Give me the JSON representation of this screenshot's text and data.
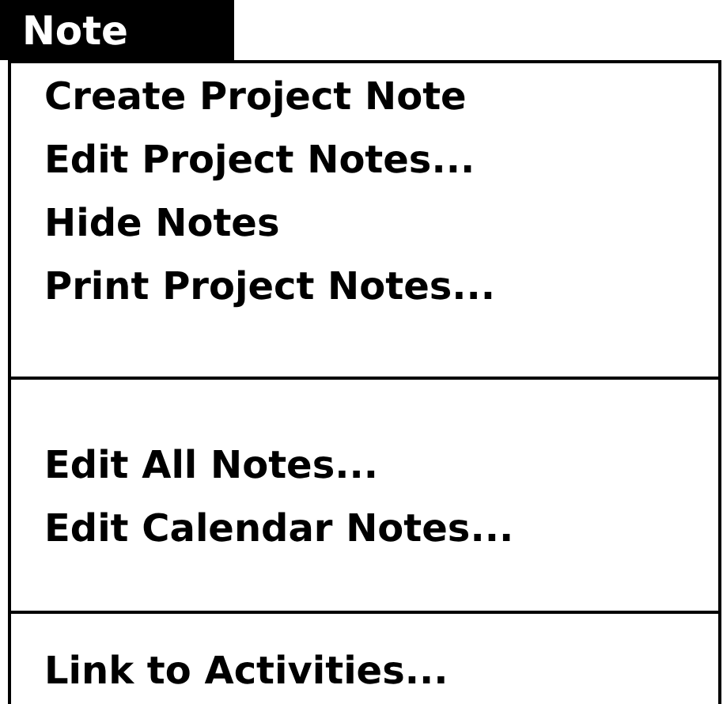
{
  "menu": {
    "title": "Note",
    "selected": true,
    "sections": [
      {
        "items": [
          {
            "label": "Create Project Note"
          },
          {
            "label": "Edit Project Notes..."
          },
          {
            "label": "Hide Notes"
          },
          {
            "label": "Print Project Notes..."
          }
        ]
      },
      {
        "items": [
          {
            "label": "Edit All Notes..."
          },
          {
            "label": "Edit Calendar Notes..."
          }
        ]
      },
      {
        "items": [
          {
            "label": "Link to Activities..."
          }
        ]
      }
    ]
  }
}
